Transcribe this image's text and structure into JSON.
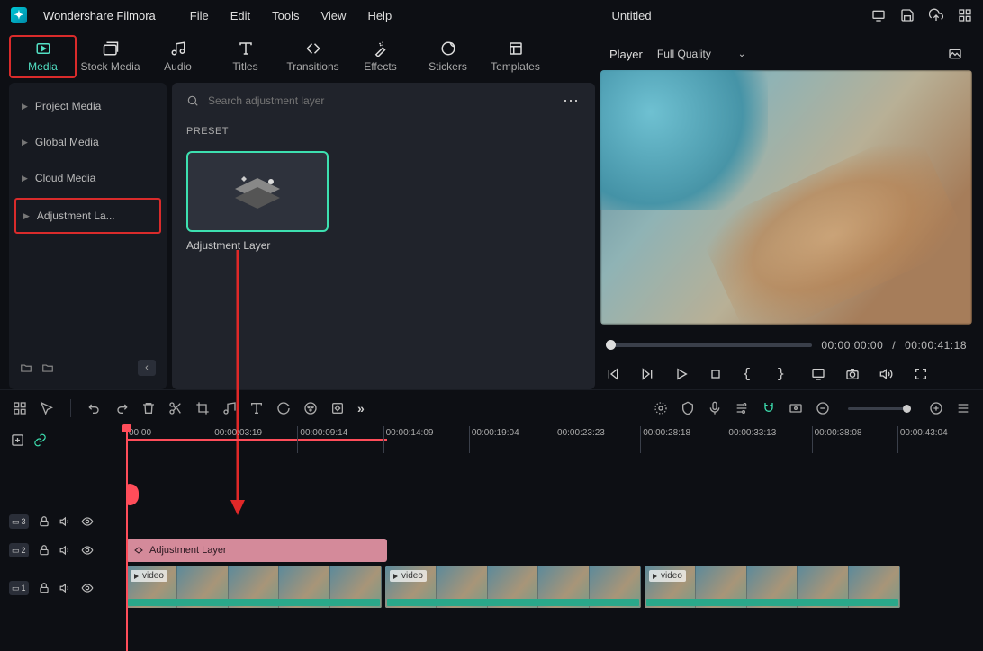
{
  "app": {
    "name": "Wondershare Filmora",
    "title": "Untitled"
  },
  "menu": [
    "File",
    "Edit",
    "Tools",
    "View",
    "Help"
  ],
  "tabs": [
    {
      "label": "Media",
      "active": true
    },
    {
      "label": "Stock Media"
    },
    {
      "label": "Audio"
    },
    {
      "label": "Titles"
    },
    {
      "label": "Transitions"
    },
    {
      "label": "Effects"
    },
    {
      "label": "Stickers"
    },
    {
      "label": "Templates"
    }
  ],
  "sidebar": {
    "items": [
      {
        "label": "Project Media"
      },
      {
        "label": "Global Media"
      },
      {
        "label": "Cloud Media"
      },
      {
        "label": "Adjustment La...",
        "active": true
      }
    ]
  },
  "search": {
    "placeholder": "Search adjustment layer"
  },
  "preset": {
    "heading": "PRESET",
    "card_name": "Adjustment Layer"
  },
  "player": {
    "label": "Player",
    "quality": "Full Quality",
    "current": "00:00:00:00",
    "separator": "/",
    "total": "00:00:41:18"
  },
  "timeline": {
    "ruler": [
      "00:00",
      "00:00:03:19",
      "00:00:09:14",
      "00:00:14:09",
      "00:00:19:04",
      "00:00:23:23",
      "00:00:28:18",
      "00:00:33:13",
      "00:00:38:08",
      "00:00:43:04"
    ],
    "adj_clip": "Adjustment Layer",
    "video_label": "video",
    "track_labels": {
      "t3": "3",
      "t2": "2",
      "t1": "1"
    }
  }
}
